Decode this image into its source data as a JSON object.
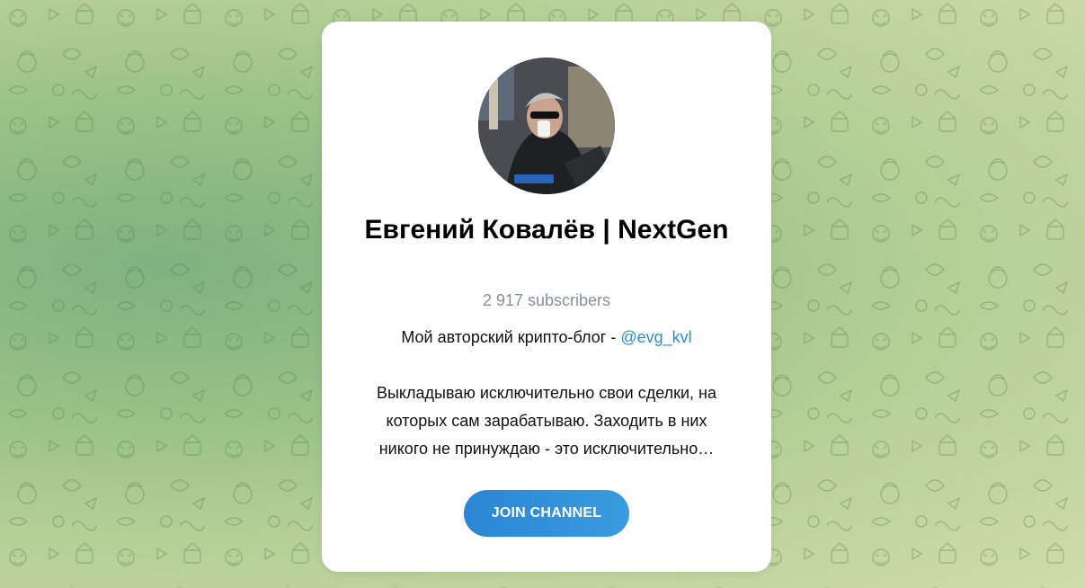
{
  "channel": {
    "title": "Евгений Ковалёв | NextGen",
    "subscribers": "2 917 subscribers",
    "description_line1_text": "Мой авторский крипто-блог - ",
    "description_link": "@evg_kvl",
    "description_line2": "Выкладываю исключительно свои сделки, на",
    "description_line3": "которых сам зарабатываю. Заходить в них",
    "description_line4": "никого не принуждаю - это исключительно…"
  },
  "join_button": {
    "label": "JOIN CHANNEL"
  },
  "colors": {
    "accent": "#2a86d4",
    "link": "#2b8dcf",
    "muted": "#8a8f95"
  }
}
